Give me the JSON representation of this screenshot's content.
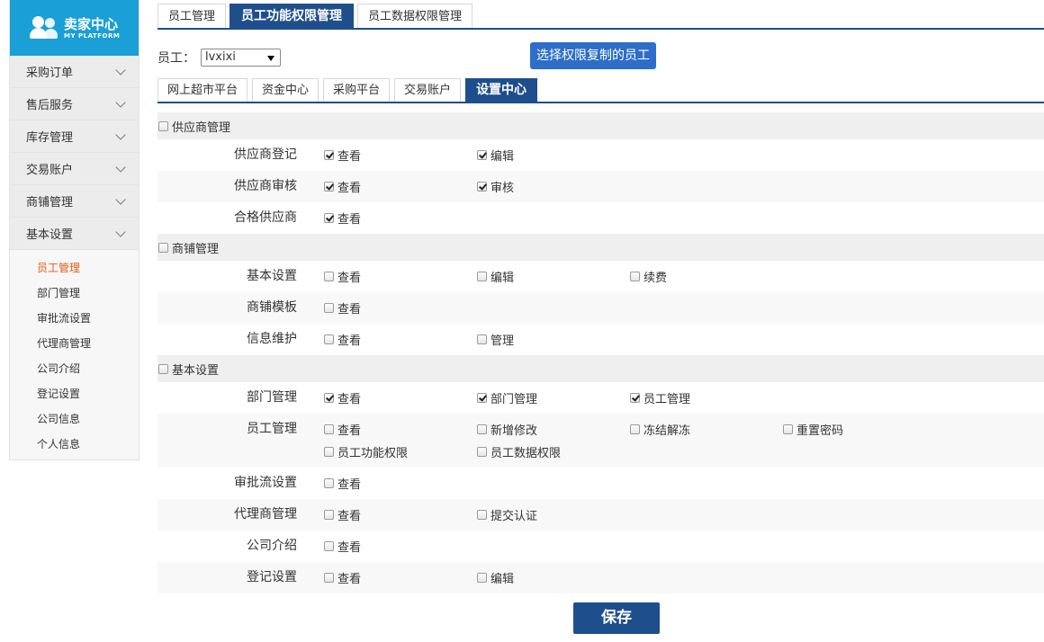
{
  "logo": {
    "title": "卖家中心",
    "subtitle": "MY PLATFORM"
  },
  "sidebar": {
    "items": [
      {
        "label": "采购订单"
      },
      {
        "label": "售后服务"
      },
      {
        "label": "库存管理"
      },
      {
        "label": "交易账户"
      },
      {
        "label": "商铺管理"
      },
      {
        "label": "基本设置"
      }
    ],
    "subitems": [
      {
        "label": "员工管理",
        "active": true
      },
      {
        "label": "部门管理"
      },
      {
        "label": "审批流设置"
      },
      {
        "label": "代理商管理"
      },
      {
        "label": "公司介绍"
      },
      {
        "label": "登记设置"
      },
      {
        "label": "公司信息"
      },
      {
        "label": "个人信息"
      }
    ]
  },
  "top_tabs": [
    {
      "label": "员工管理"
    },
    {
      "label": "员工功能权限管理",
      "active": true
    },
    {
      "label": "员工数据权限管理"
    }
  ],
  "employee": {
    "label": "员工：",
    "value": "lvxixi"
  },
  "copy_button": "选择权限复制的员工",
  "sub_tabs": [
    {
      "label": "网上超市平台"
    },
    {
      "label": "资金中心"
    },
    {
      "label": "采购平台"
    },
    {
      "label": "交易账户"
    },
    {
      "label": "设置中心",
      "active": true
    }
  ],
  "groups": [
    {
      "title": "供应商管理",
      "rows": [
        {
          "name": "供应商登记",
          "options": [
            {
              "label": "查看",
              "checked": true
            },
            {
              "label": "编辑",
              "checked": true
            }
          ]
        },
        {
          "name": "供应商审核",
          "options": [
            {
              "label": "查看",
              "checked": true
            },
            {
              "label": "审核",
              "checked": true
            }
          ]
        },
        {
          "name": "合格供应商",
          "options": [
            {
              "label": "查看",
              "checked": true
            }
          ]
        }
      ]
    },
    {
      "title": "商铺管理",
      "rows": [
        {
          "name": "基本设置",
          "options": [
            {
              "label": "查看",
              "checked": false
            },
            {
              "label": "编辑",
              "checked": false
            },
            {
              "label": "续费",
              "checked": false
            }
          ]
        },
        {
          "name": "商铺模板",
          "options": [
            {
              "label": "查看",
              "checked": false
            }
          ]
        },
        {
          "name": "信息维护",
          "options": [
            {
              "label": "查看",
              "checked": false
            },
            {
              "label": "管理",
              "checked": false
            }
          ]
        }
      ]
    },
    {
      "title": "基本设置",
      "rows": [
        {
          "name": "部门管理",
          "options": [
            {
              "label": "查看",
              "checked": true
            },
            {
              "label": "部门管理",
              "checked": true
            },
            {
              "label": "员工管理",
              "checked": true
            }
          ]
        },
        {
          "name": "员工管理",
          "options": [
            {
              "label": "查看",
              "checked": false
            },
            {
              "label": "新增修改",
              "checked": false
            },
            {
              "label": "冻结解冻",
              "checked": false
            },
            {
              "label": "重置密码",
              "checked": false
            },
            {
              "label": "员工功能权限",
              "checked": false
            },
            {
              "label": "员工数据权限",
              "checked": false
            }
          ]
        },
        {
          "name": "审批流设置",
          "options": [
            {
              "label": "查看",
              "checked": false
            }
          ]
        },
        {
          "name": "代理商管理",
          "options": [
            {
              "label": "查看",
              "checked": false
            },
            {
              "label": "提交认证",
              "checked": false
            }
          ]
        },
        {
          "name": "公司介绍",
          "options": [
            {
              "label": "查看",
              "checked": false
            }
          ]
        },
        {
          "name": "登记设置",
          "options": [
            {
              "label": "查看",
              "checked": false
            },
            {
              "label": "编辑",
              "checked": false
            }
          ]
        }
      ]
    }
  ],
  "save_button": "保存"
}
